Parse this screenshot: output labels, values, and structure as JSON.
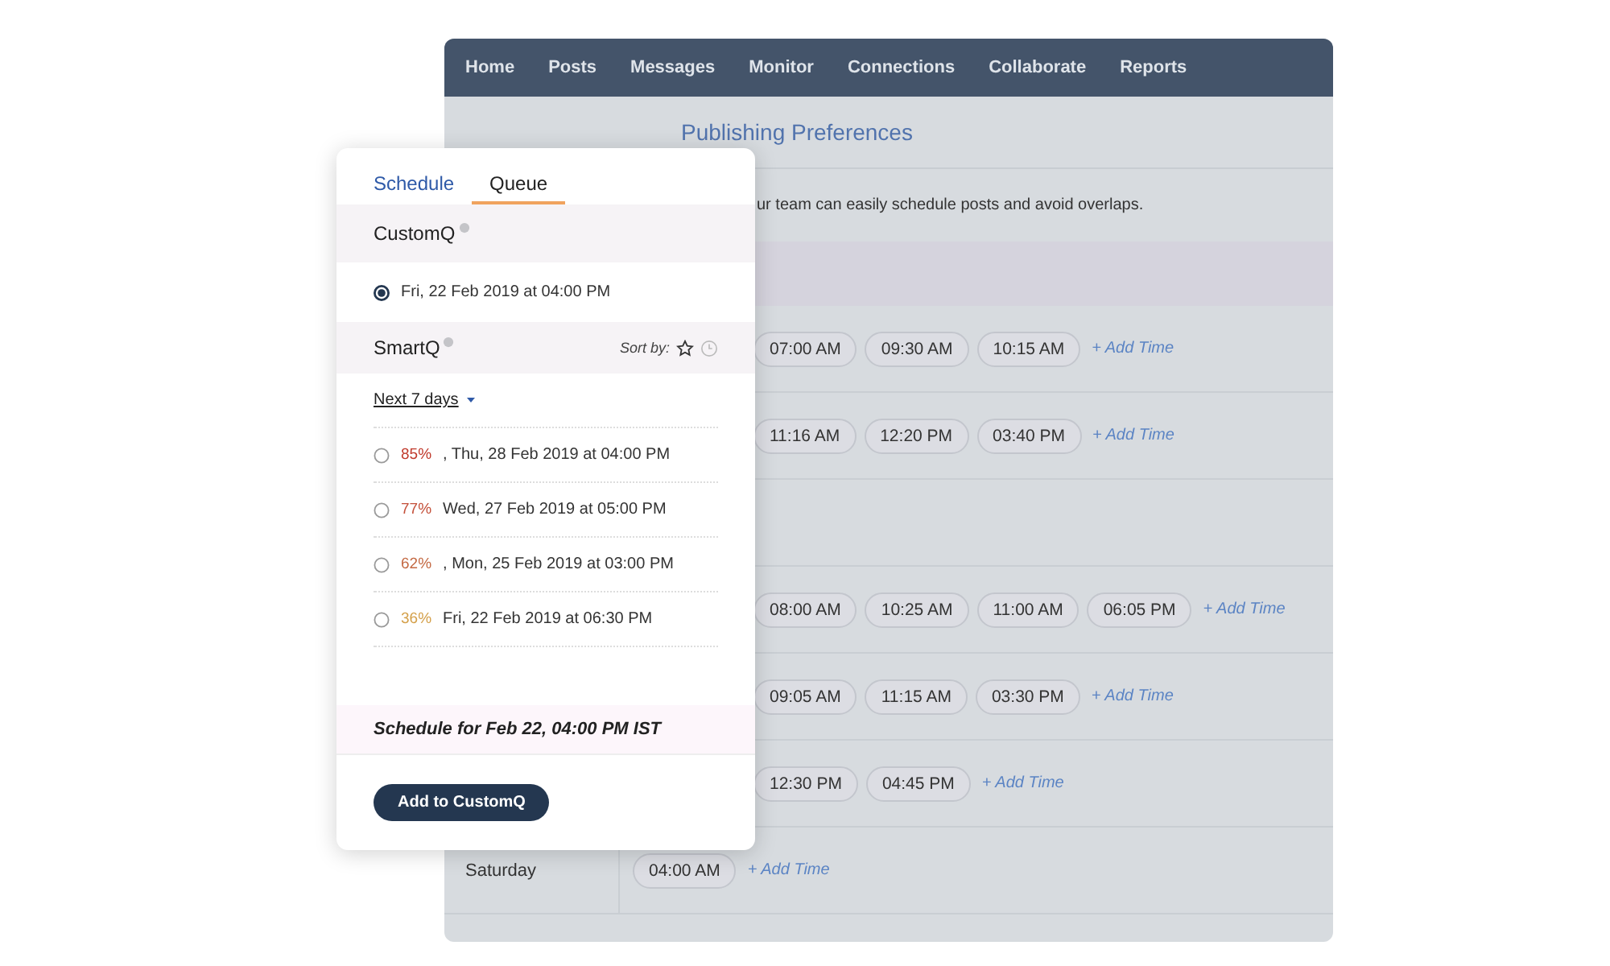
{
  "nav": [
    "Home",
    "Posts",
    "Messages",
    "Monitor",
    "Connections",
    "Collaborate",
    "Reports"
  ],
  "page": {
    "title": "Publishing Preferences",
    "description": "ur team can easily schedule posts and avoid overlaps.",
    "rows": [
      {
        "kind": "band"
      },
      {
        "kind": "times",
        "times": [
          "07:00 AM",
          "09:30 AM",
          "10:15 AM"
        ],
        "add": "+ Add Time"
      },
      {
        "kind": "times",
        "times": [
          "11:16 AM",
          "12:20 PM",
          "03:40 PM"
        ],
        "add": "+ Add Time"
      },
      {
        "kind": "blank"
      },
      {
        "kind": "times",
        "times": [
          "08:00 AM",
          "10:25 AM",
          "11:00 AM",
          "06:05 PM"
        ],
        "add": "+ Add Time"
      },
      {
        "kind": "times",
        "times": [
          "09:05 AM",
          "11:15 AM",
          "03:30 PM"
        ],
        "add": "+ Add Time"
      },
      {
        "kind": "times",
        "times": [
          "12:30 PM",
          "04:45 PM"
        ],
        "add": "+ Add Time"
      },
      {
        "kind": "times",
        "day": "Saturday",
        "times": [
          "04:00 AM"
        ],
        "add": "+ Add Time"
      }
    ]
  },
  "popup": {
    "tabs": [
      {
        "label": "Schedule",
        "selected": false
      },
      {
        "label": "Queue",
        "selected": true
      }
    ],
    "customq": {
      "title": "CustomQ",
      "options": [
        {
          "label": "Fri, 22 Feb 2019 at 04:00 PM",
          "selected": true
        }
      ]
    },
    "smartq": {
      "title": "SmartQ",
      "sort_label": "Sort by:",
      "range": "Next 7 days",
      "options": [
        {
          "pct": "85%",
          "sep": ",",
          "color": "#c0392b",
          "label": "Thu, 28 Feb 2019 at 04:00 PM",
          "selected": false
        },
        {
          "pct": "77%",
          "color": "#c4503a",
          "label": "Wed, 27 Feb 2019 at 05:00 PM",
          "selected": false
        },
        {
          "pct": "62%",
          "sep": ",",
          "color": "#c46a44",
          "label": "Mon, 25 Feb 2019 at 03:00 PM",
          "selected": false
        },
        {
          "pct": "36%",
          "color": "#d4a04a",
          "label": "Fri, 22 Feb 2019 at 06:30 PM",
          "selected": false
        }
      ]
    },
    "footer": "Schedule for Feb 22, 04:00 PM IST",
    "button": "Add to CustomQ"
  }
}
